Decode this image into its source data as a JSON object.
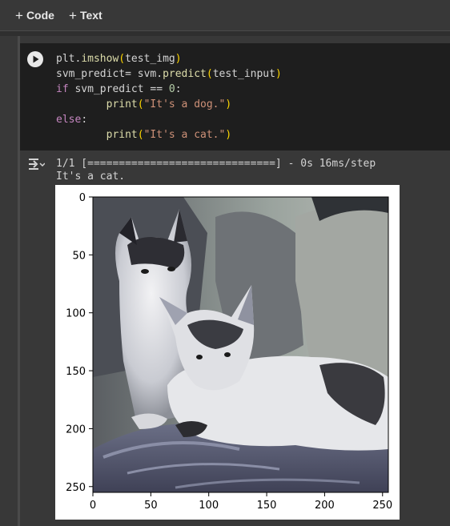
{
  "toolbar": {
    "add_code_label": "Code",
    "add_text_label": "Text"
  },
  "cell": {
    "code_lines": [
      "plt.imshow(test_img)",
      "svm_predict= svm.predict(test_input)",
      "if svm_predict == 0:",
      "        print(\"It's a dog.\")",
      "else:",
      "        print(\"It's a cat.\")"
    ]
  },
  "output": {
    "progress_line": "1/1 [==============================] - 0s 16ms/step",
    "result_line": "It's a cat."
  },
  "chart_data": {
    "type": "image",
    "image_description_semantic": "cat-photo",
    "x_ticks": [
      0,
      50,
      100,
      150,
      200,
      250
    ],
    "y_ticks": [
      0,
      50,
      100,
      150,
      200,
      250
    ],
    "xlim": [
      0,
      255
    ],
    "ylim": [
      255,
      0
    ]
  },
  "colors": {
    "background": "#383838",
    "code_bg": "#1e1e1e",
    "keyword": "#c586c0",
    "function": "#dcdcaa",
    "string": "#ce9178",
    "number": "#b5cea8",
    "bracket": "#ffd700"
  }
}
